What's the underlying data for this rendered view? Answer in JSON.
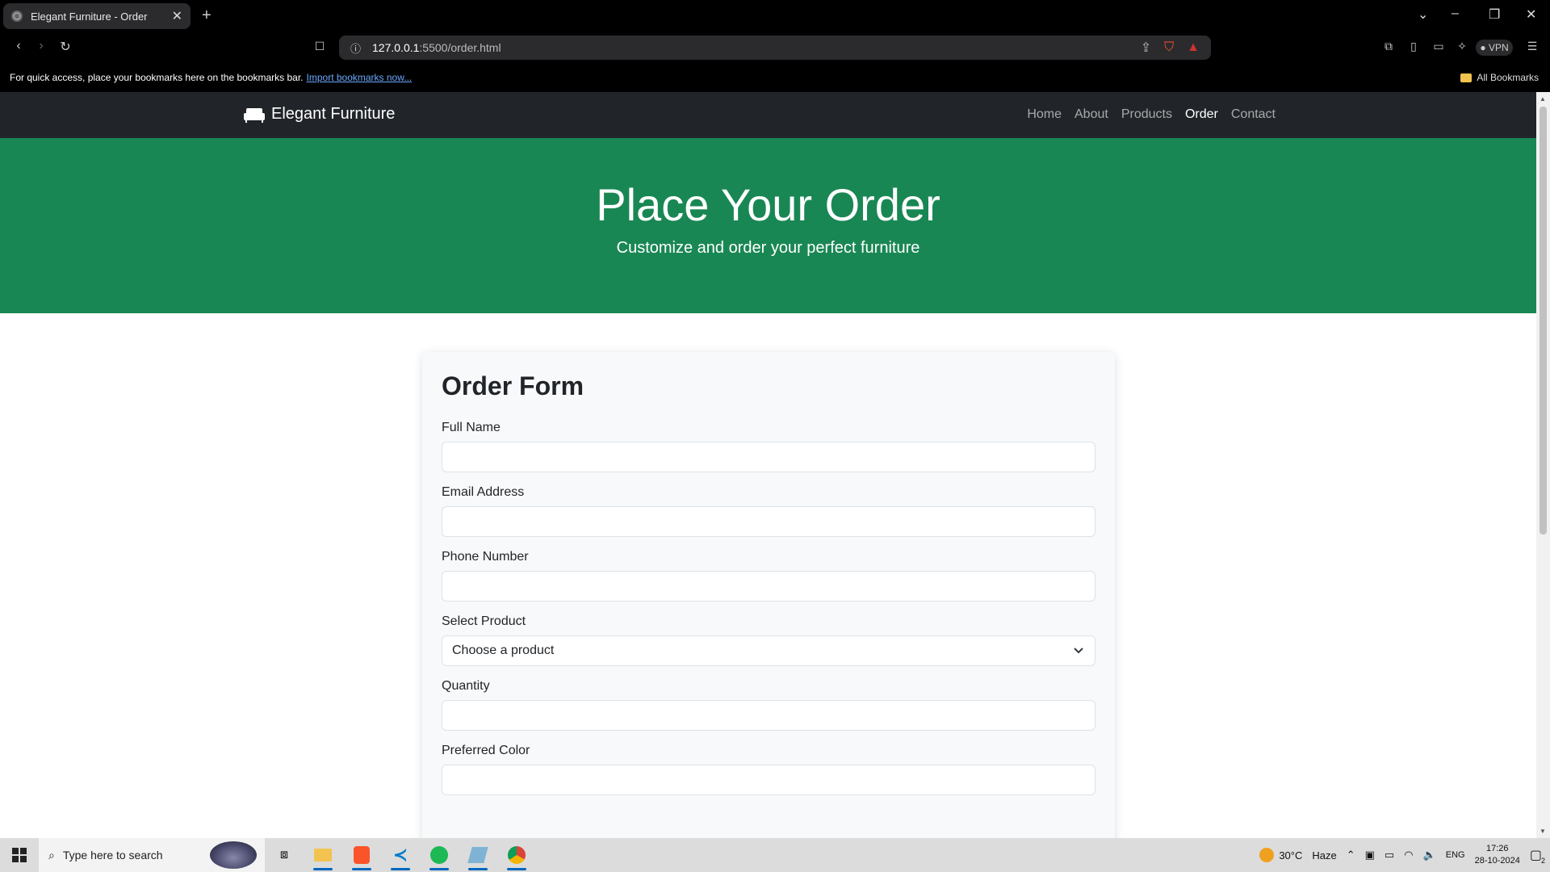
{
  "browser": {
    "tab_title": "Elegant Furniture - Order",
    "url_host": "127.0.0.1",
    "url_path": ":5500/order.html",
    "bookmarks_message": "For quick access, place your bookmarks here on the bookmarks bar.",
    "bookmarks_link": "Import bookmarks now...",
    "all_bookmarks": "All Bookmarks",
    "vpn_label": "VPN"
  },
  "site": {
    "brand": "Elegant Furniture",
    "nav": [
      "Home",
      "About",
      "Products",
      "Order",
      "Contact"
    ],
    "active_nav": "Order",
    "hero_title": "Place Your Order",
    "hero_subtitle": "Customize and order your perfect furniture",
    "accent_color": "#198754"
  },
  "form": {
    "title": "Order Form",
    "full_name_label": "Full Name",
    "full_name_value": "",
    "email_label": "Email Address",
    "email_value": "",
    "phone_label": "Phone Number",
    "phone_value": "",
    "product_label": "Select Product",
    "product_selected": "Choose a product",
    "quantity_label": "Quantity",
    "quantity_value": "",
    "color_label": "Preferred Color",
    "color_value": ""
  },
  "taskbar": {
    "search_placeholder": "Type here to search",
    "weather_temp": "30°C",
    "weather_desc": "Haze",
    "lang": "ENG",
    "time": "17:26",
    "date": "28-10-2024",
    "notifications": "2"
  }
}
